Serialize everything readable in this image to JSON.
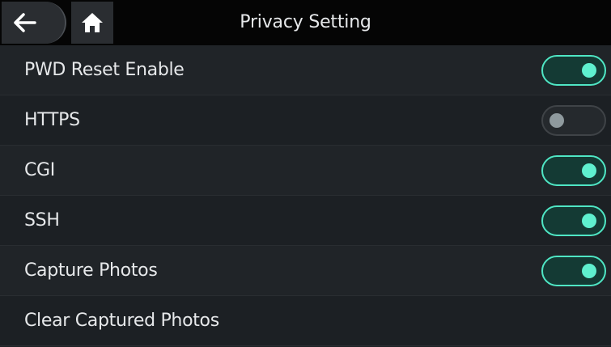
{
  "header": {
    "title": "Privacy Setting",
    "back_icon": "back-arrow-icon",
    "home_icon": "home-icon"
  },
  "settings": [
    {
      "label": "PWD Reset Enable",
      "toggle": "on"
    },
    {
      "label": "HTTPS",
      "toggle": "off"
    },
    {
      "label": "CGI",
      "toggle": "on"
    },
    {
      "label": "SSH",
      "toggle": "on"
    },
    {
      "label": "Capture Photos",
      "toggle": "on"
    },
    {
      "label": "Clear Captured Photos",
      "toggle": null
    }
  ],
  "colors": {
    "toggle_on_accent": "#4fe6c4",
    "toggle_off_knob": "#8f9a9e",
    "header_bg": "#050505",
    "list_bg": "#1f2327"
  }
}
